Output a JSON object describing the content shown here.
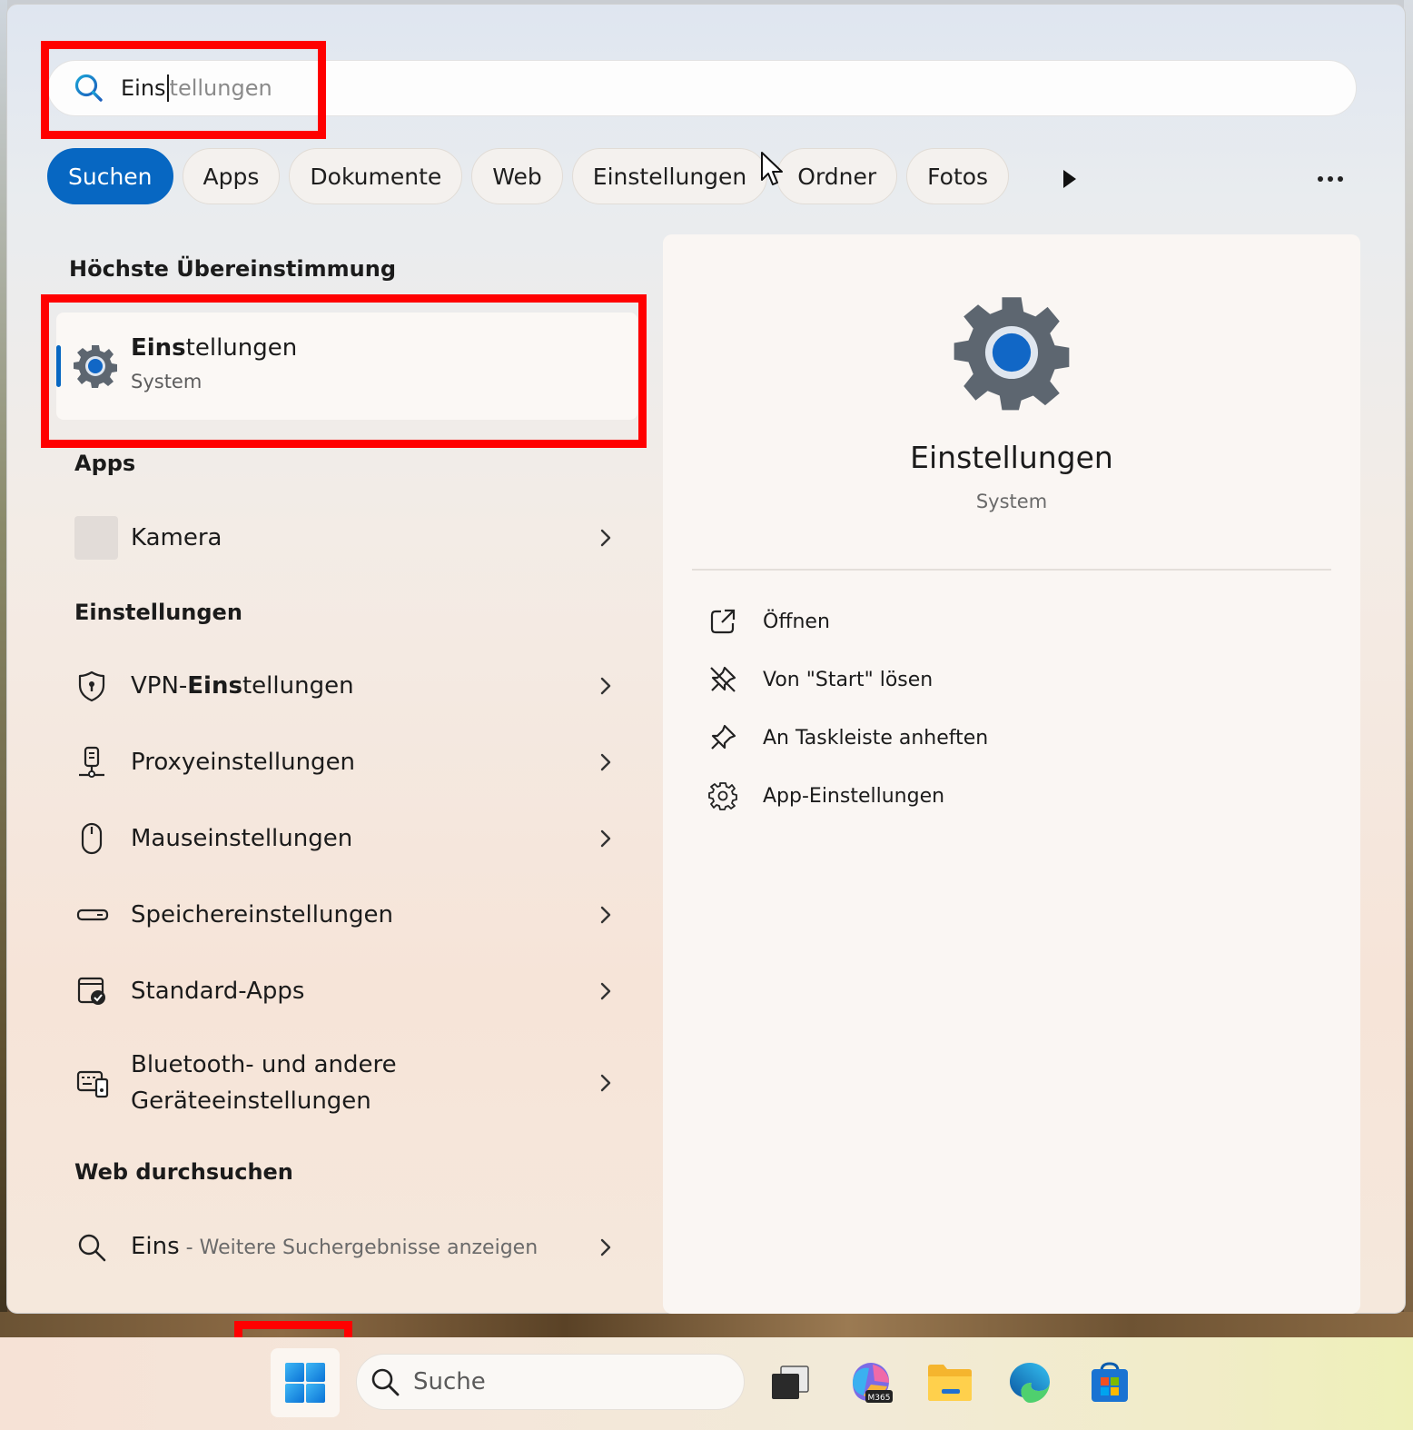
{
  "search": {
    "typed": "Eins",
    "suggestion": "tellungen"
  },
  "filters": [
    "Suchen",
    "Apps",
    "Dokumente",
    "Web",
    "Einstellungen",
    "Ordner",
    "Fotos"
  ],
  "sections": {
    "best_match": "Höchste Übereinstimmung",
    "apps": "Apps",
    "settings": "Einstellungen",
    "web": "Web durchsuchen"
  },
  "best_match": {
    "title_bold": "Eins",
    "title_rest": "tellungen",
    "subtitle": "System"
  },
  "apps": [
    {
      "label": "Kamera"
    }
  ],
  "settings_items": [
    {
      "pre": "VPN-",
      "bold": "Eins",
      "post": "tellungen",
      "icon": "shield-icon"
    },
    {
      "pre": "Proxyeinstellungen",
      "bold": "",
      "post": "",
      "icon": "proxy-icon"
    },
    {
      "pre": "Mauseinstellungen",
      "bold": "",
      "post": "",
      "icon": "mouse-icon"
    },
    {
      "pre": "Speichereinstellungen",
      "bold": "",
      "post": "",
      "icon": "storage-icon"
    },
    {
      "pre": "Standard-Apps",
      "bold": "",
      "post": "",
      "icon": "default-apps-icon"
    },
    {
      "pre": "Bluetooth- und andere",
      "bold": "",
      "post": "Geräteeinstellungen",
      "icon": "devices-icon"
    }
  ],
  "web": {
    "query": "Eins",
    "hint": " - Weitere Suchergebnisse anzeigen"
  },
  "detail": {
    "title": "Einstellungen",
    "subtitle": "System",
    "actions": [
      "Öffnen",
      "Von \"Start\" lösen",
      "An Taskleiste anheften",
      "App-Einstellungen"
    ]
  },
  "taskbar": {
    "search_placeholder": "Suche",
    "apps": [
      "task-view-icon",
      "m365-copilot-icon",
      "file-explorer-icon",
      "edge-icon",
      "store-icon"
    ]
  },
  "colors": {
    "accent": "#0767c2",
    "highlight": "#ff0000"
  }
}
